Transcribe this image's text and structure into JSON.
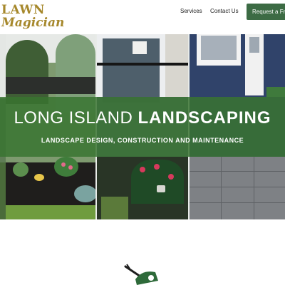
{
  "header": {
    "logo": {
      "line1": "LAWN",
      "line2": "Magician"
    },
    "nav": [
      {
        "label": "Services"
      },
      {
        "label": "Contact Us"
      }
    ],
    "cta_label": "Request a Free"
  },
  "hero": {
    "title_light": "LONG ISLAND",
    "title_bold": "LANDSCAPING",
    "subtitle": "LANDSCAPE DESIGN, CONSTRUCTION AND MAINTENANCE"
  },
  "colors": {
    "brand_gold": "#a6882c",
    "brand_green": "#3c6b44",
    "band_green": "#387430"
  },
  "icons": [
    "lawnmower-logo-icon"
  ]
}
